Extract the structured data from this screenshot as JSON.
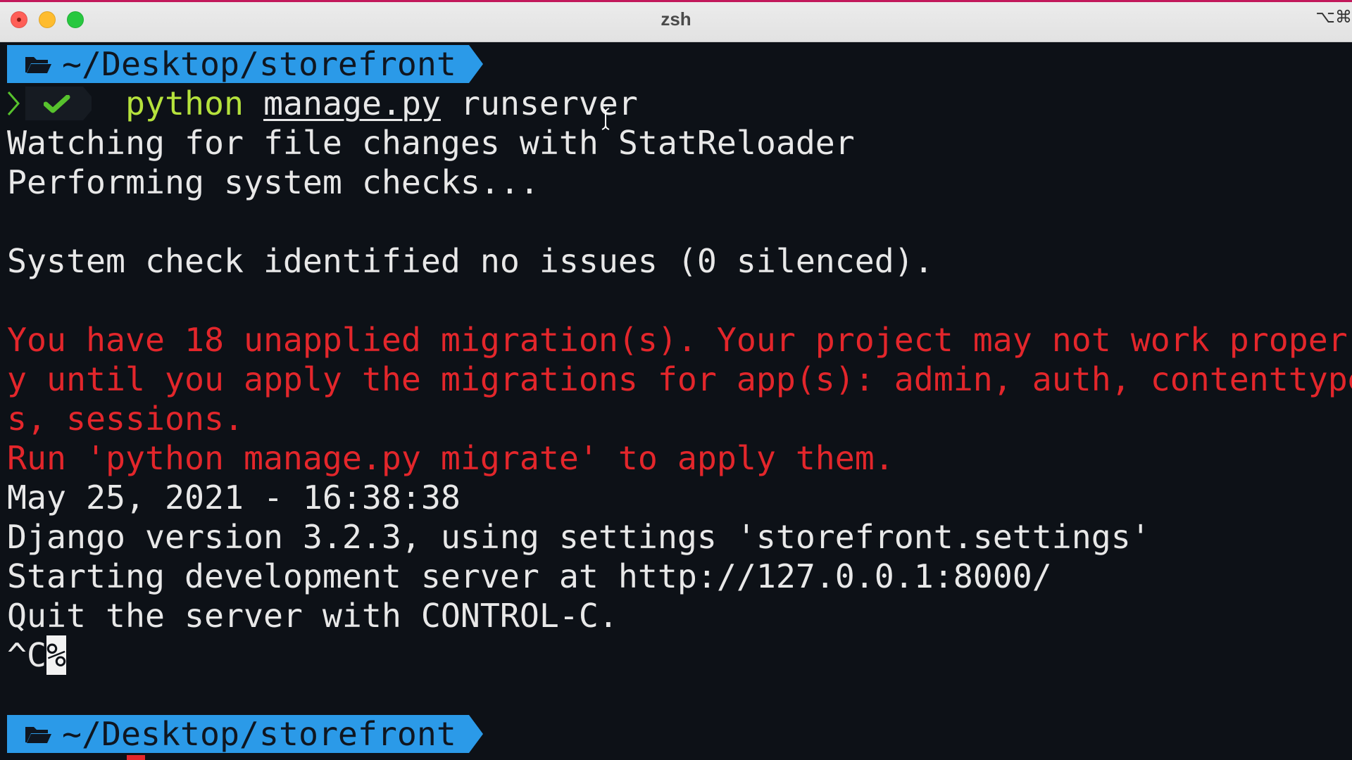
{
  "window": {
    "title": "zsh",
    "shortcut_hint": "⌥⌘",
    "accent_color": "#c2185b"
  },
  "prompt": {
    "path": "~/Desktop/storefront",
    "segment_color": "#2b9ae8",
    "folder_icon": "folder-open-icon",
    "status_icon": "checkmark-icon",
    "status_color": "#57c22d"
  },
  "command": {
    "program": "python",
    "file": "manage.py",
    "argument": "runserver"
  },
  "output": {
    "line1": "Watching for file changes with StatReloader",
    "line2": "Performing system checks...",
    "line3": "System check identified no issues (0 silenced).",
    "warn1": "You have 18 unapplied migration(s). Your project may not work proper",
    "warn2": "y until you apply the migrations for app(s): admin, auth, contenttype",
    "warn3": "s, sessions.",
    "warn4": "Run 'python manage.py migrate' to apply them.",
    "line4": "May 25, 2021 - 16:38:38",
    "line5": "Django version 3.2.3, using settings 'storefront.settings'",
    "line6": "Starting development server at http://127.0.0.1:8000/",
    "line7": "Quit the server with CONTROL-C.",
    "interrupt": "^C",
    "eol_marker": "%"
  },
  "colors": {
    "background": "#0d1117",
    "text": "#e8e8e8",
    "warning": "#e3262b",
    "command": "#b5e23c"
  }
}
